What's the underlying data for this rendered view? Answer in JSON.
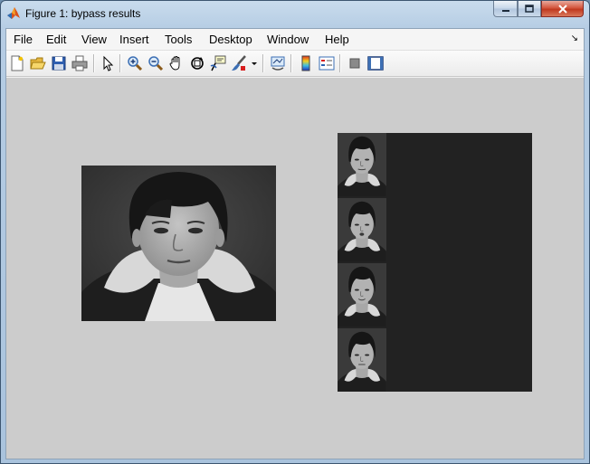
{
  "window": {
    "title": "Figure 1: bypass results",
    "app_icon": "matlab-icon",
    "controls": [
      "minimize-icon",
      "maximize-icon",
      "close-icon"
    ]
  },
  "menubar": {
    "items": [
      "File",
      "Edit",
      "View",
      "Insert",
      "Tools",
      "Desktop",
      "Window",
      "Help"
    ]
  },
  "toolbar": {
    "buttons": [
      "new-figure-icon",
      "open-file-icon",
      "save-icon",
      "print-icon",
      "edit-plot-arrow-icon",
      "zoom-in-icon",
      "zoom-out-icon",
      "pan-hand-icon",
      "rotate-3d-icon",
      "data-cursor-icon",
      "brush-icon",
      "brush-dropdown-icon",
      "link-plot-icon",
      "insert-colorbar-icon",
      "insert-legend-icon",
      "hide-plot-tools-icon",
      "show-plot-tools-icon"
    ]
  },
  "figure": {
    "background": "#cccccc",
    "images": [
      {
        "name": "face-image",
        "content": "grayscale portrait"
      },
      {
        "name": "face-montage",
        "tiles": 4,
        "background": "#222222"
      }
    ]
  }
}
